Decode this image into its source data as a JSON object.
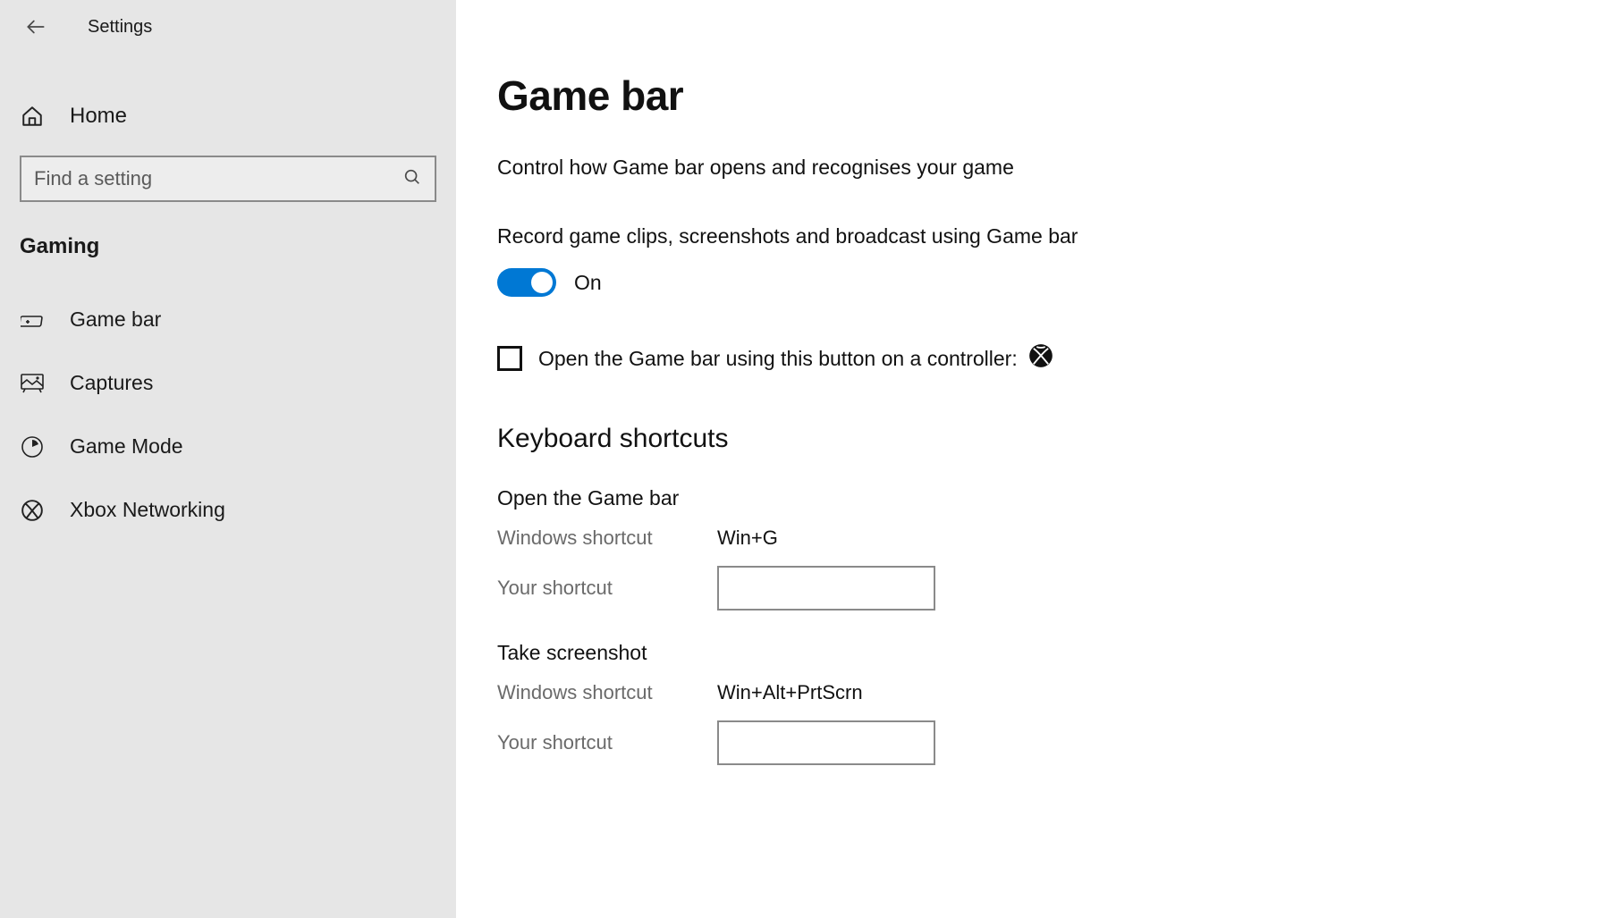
{
  "header": {
    "app_title": "Settings"
  },
  "sidebar": {
    "home_label": "Home",
    "section_label": "Gaming",
    "items": [
      {
        "label": "Game bar"
      },
      {
        "label": "Captures"
      },
      {
        "label": "Game Mode"
      },
      {
        "label": "Xbox Networking"
      }
    ]
  },
  "search": {
    "placeholder": "Find a setting",
    "value": ""
  },
  "main": {
    "page_title": "Game bar",
    "intro": "Control how Game bar opens and recognises your game",
    "record_label": "Record game clips, screenshots and broadcast using Game bar",
    "toggle_state_label": "On",
    "controller_checkbox_label": "Open the Game bar using this button on a controller:",
    "shortcuts_heading": "Keyboard shortcuts",
    "shortcuts": [
      {
        "title": "Open the Game bar",
        "windows_label": "Windows shortcut",
        "windows_value": "Win+G",
        "your_label": "Your shortcut",
        "your_value": ""
      },
      {
        "title": "Take screenshot",
        "windows_label": "Windows shortcut",
        "windows_value": "Win+Alt+PrtScrn",
        "your_label": "Your shortcut",
        "your_value": ""
      }
    ]
  },
  "colors": {
    "accent": "#0078d4",
    "sidebar_bg": "#e6e6e6"
  }
}
